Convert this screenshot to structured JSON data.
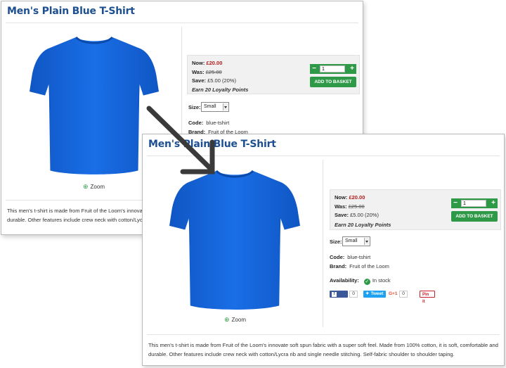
{
  "product": {
    "title": "Men's Plain Blue T-Shirt",
    "zoom_label": "Zoom",
    "now_label": "Now:",
    "now_price": "£20.00",
    "was_label": "Was:",
    "was_price": "£25.00",
    "save_label": "Save:",
    "save_value": "£5.00 (20%)",
    "loyalty": "Earn 20 Loyalty Points",
    "quantity": "1",
    "minus": "−",
    "plus": "+",
    "basket_label": "ADD TO BASKET",
    "size_label": "Size:",
    "size_value": "Small",
    "code_label": "Code:",
    "code_value": "blue-tshirt",
    "brand_label": "Brand:",
    "brand_value": "Fruit of the Loom",
    "availability_label": "Availability:",
    "availability_value": "In stock",
    "description_line1": "This men's t-shirt is made from Fruit of the Loom's innovate soft spun fabric with a super soft feel. Made from 100% cotton, it is soft, comfortable and",
    "description_line2": "durable. Other features include crew neck with cotton/Lycra rib and single needle stitching. Self-fabric shoulder to shoulder taping.",
    "back_desc_line1": "This men's t-shirt is made from Fruit of the Loom's innovat",
    "back_desc_line2": "durable. Other features include crew neck with cotton/Lycra"
  },
  "social": {
    "like_label": "Like",
    "like_count": "0",
    "tweet_label": "Tweet",
    "gplus_label": "G+1",
    "gplus_count": "0",
    "pin_label": "Pin it"
  },
  "colors": {
    "title": "#1d4f91",
    "shirt": "#1565d8",
    "accent_green": "#2e9a47",
    "price_red": "#b01c1c"
  }
}
